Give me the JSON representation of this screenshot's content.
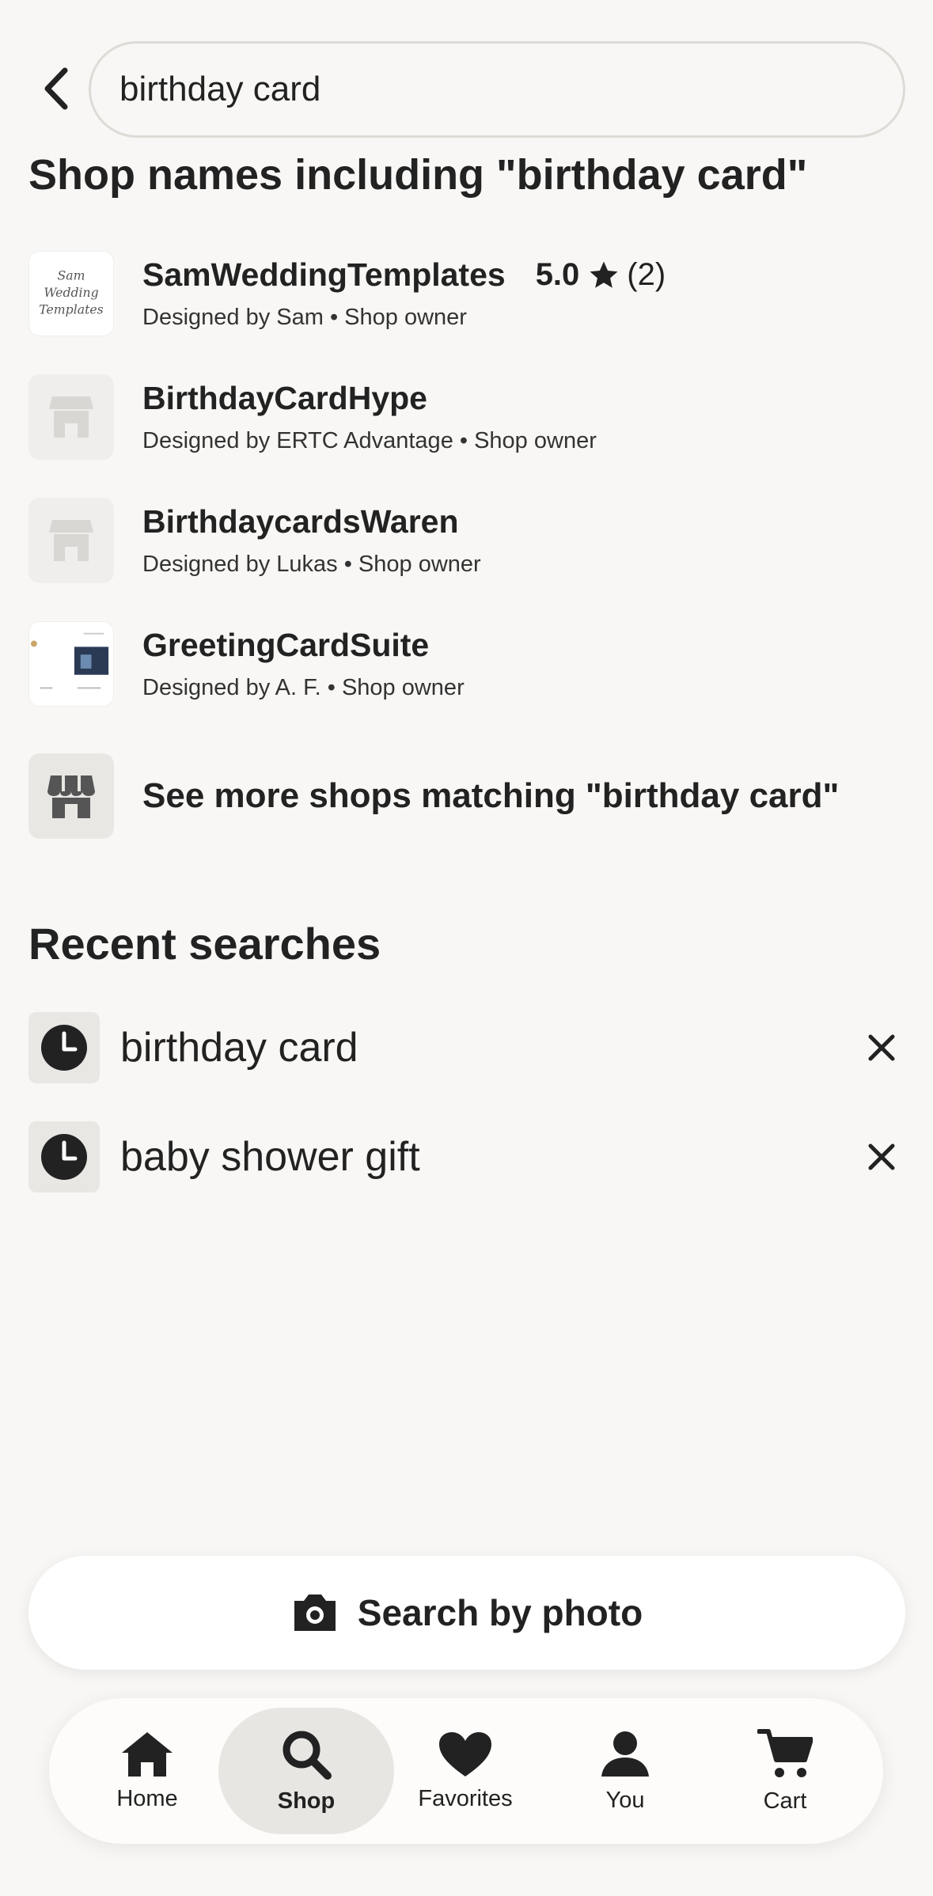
{
  "search": {
    "value": "birthday card"
  },
  "shops_section": {
    "heading": "Shop names including \"birthday card\""
  },
  "shops": [
    {
      "name": "SamWeddingTemplates",
      "rating": "5.0",
      "review_count": "(2)",
      "subtitle": "Designed by Sam • Shop owner",
      "thumb": "logo",
      "thumb_lines": [
        "Sam",
        "Wedding",
        "Templates"
      ]
    },
    {
      "name": "BirthdayCardHype",
      "rating": "",
      "review_count": "",
      "subtitle": "Designed by ERTC Advantage • Shop owner",
      "thumb": "storefront"
    },
    {
      "name": "BirthdaycardsWaren",
      "rating": "",
      "review_count": "",
      "subtitle": "Designed by Lukas • Shop owner",
      "thumb": "storefront"
    },
    {
      "name": "GreetingCardSuite",
      "rating": "",
      "review_count": "",
      "subtitle": "Designed by A. F. • Shop owner",
      "thumb": "image"
    }
  ],
  "see_more": {
    "label": "See more shops matching \"birthday card\""
  },
  "recent": {
    "heading": "Recent searches",
    "items": [
      {
        "label": "birthday card"
      },
      {
        "label": "baby shower gift"
      }
    ]
  },
  "photo_search": {
    "label": "Search by photo"
  },
  "nav": {
    "active": "Shop",
    "items": [
      {
        "label": "Home",
        "icon": "home-icon"
      },
      {
        "label": "Shop",
        "icon": "search-icon"
      },
      {
        "label": "Favorites",
        "icon": "heart-icon"
      },
      {
        "label": "You",
        "icon": "person-icon"
      },
      {
        "label": "Cart",
        "icon": "cart-icon"
      }
    ]
  }
}
